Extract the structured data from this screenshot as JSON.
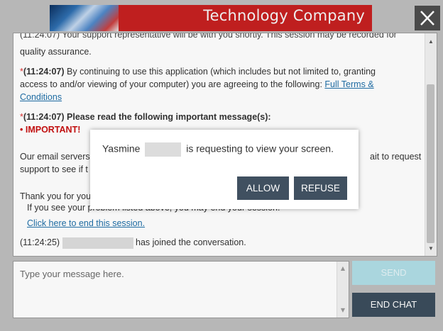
{
  "header": {
    "company_name": "Technology Company",
    "close_icon": "close-icon",
    "accent_color": "#c62020"
  },
  "transcript": {
    "line1_partial": "(11:24:07) Your support representative will be with you shortly. This session may be recorded for",
    "line1_cont": "quality assurance.",
    "msg2_marker": "*",
    "msg2_time": "(11:24:07)",
    "msg2_text": " By continuing to use this application (which includes but not limited to, granting",
    "msg2_text2": "access to and/or viewing of your computer) you are agreeing to the following: ",
    "msg2_link": "Full Terms &",
    "msg2_link2": "Conditions",
    "msg3_marker": "*",
    "msg3_text": "(11:24:07) Please read the following important message(s):",
    "important_bullet": "• IMPORTANT!",
    "email_left": "Our email servers",
    "email_right": "ait to request",
    "support_left": "support to see if t",
    "thanks_left": "Thank you for you",
    "problem_text": "If you see your problem listed above, you may end your session.",
    "end_session_link": "Click here to end this session.",
    "join_time": "(11:24:25)",
    "join_text": "has joined the conversation."
  },
  "modal": {
    "requester_name": "Yasmine",
    "message": "is requesting to view your screen.",
    "allow_label": "ALLOW",
    "refuse_label": "REFUSE"
  },
  "composer": {
    "placeholder": "Type your message here.",
    "send_label": "SEND",
    "end_chat_label": "END CHAT"
  }
}
